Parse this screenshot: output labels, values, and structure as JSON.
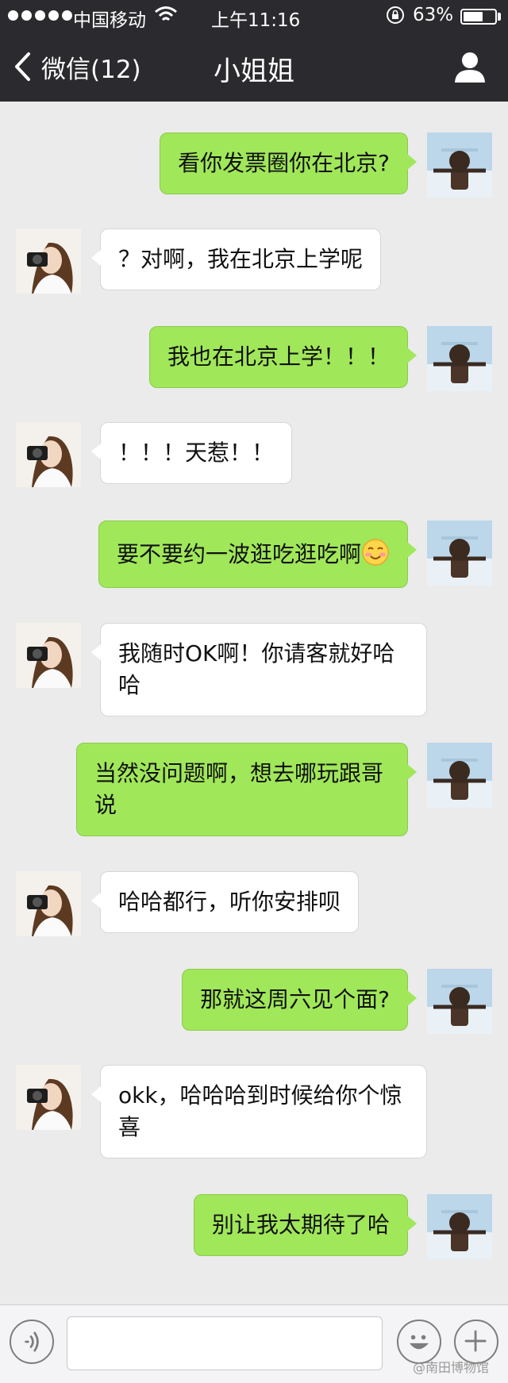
{
  "status_bar": {
    "carrier": "中国移动",
    "time": "上午11:16",
    "battery_percent": "63%",
    "battery_level": 0.63,
    "signal_bars": 5,
    "icons": [
      "signal-dots-icon",
      "wifi-icon",
      "rotation-lock-icon",
      "battery-icon"
    ]
  },
  "nav": {
    "back_label": "微信(12)",
    "title": "小姐姐",
    "icons": [
      "back-chevron-icon",
      "contact-profile-icon"
    ]
  },
  "messages": [
    {
      "from": "me",
      "text": "看你发票圈你在北京?"
    },
    {
      "from": "her",
      "text": "？对啊，我在北京上学呢"
    },
    {
      "from": "me",
      "text": "我也在北京上学！！！"
    },
    {
      "from": "her",
      "text": "！！！天惹！！"
    },
    {
      "from": "me",
      "text": "要不要约一波逛吃逛吃啊",
      "emoji": "blushing-smile-emoji"
    },
    {
      "from": "her",
      "text_lines": [
        "我随时OK啊！你请客就好哈",
        "哈"
      ]
    },
    {
      "from": "me",
      "text_lines": [
        "当然没问题啊，想去哪玩跟哥",
        "说"
      ]
    },
    {
      "from": "her",
      "text": "哈哈都行，听你安排呗"
    },
    {
      "from": "me",
      "text": "那就这周六见个面?"
    },
    {
      "from": "her",
      "text_lines": [
        "okk，哈哈哈到时候给你个惊",
        "喜"
      ]
    },
    {
      "from": "me",
      "text": "别让我太期待了哈"
    }
  ],
  "input_bar": {
    "text_value": "",
    "icons": [
      "voice-icon",
      "emoji-icon",
      "plus-icon"
    ]
  },
  "watermark": "@南田博物馆",
  "colors": {
    "header_bg": "#2b2b2f",
    "chat_bg": "#ebebeb",
    "my_bubble": "#a0e75a",
    "her_bubble": "#ffffff"
  }
}
